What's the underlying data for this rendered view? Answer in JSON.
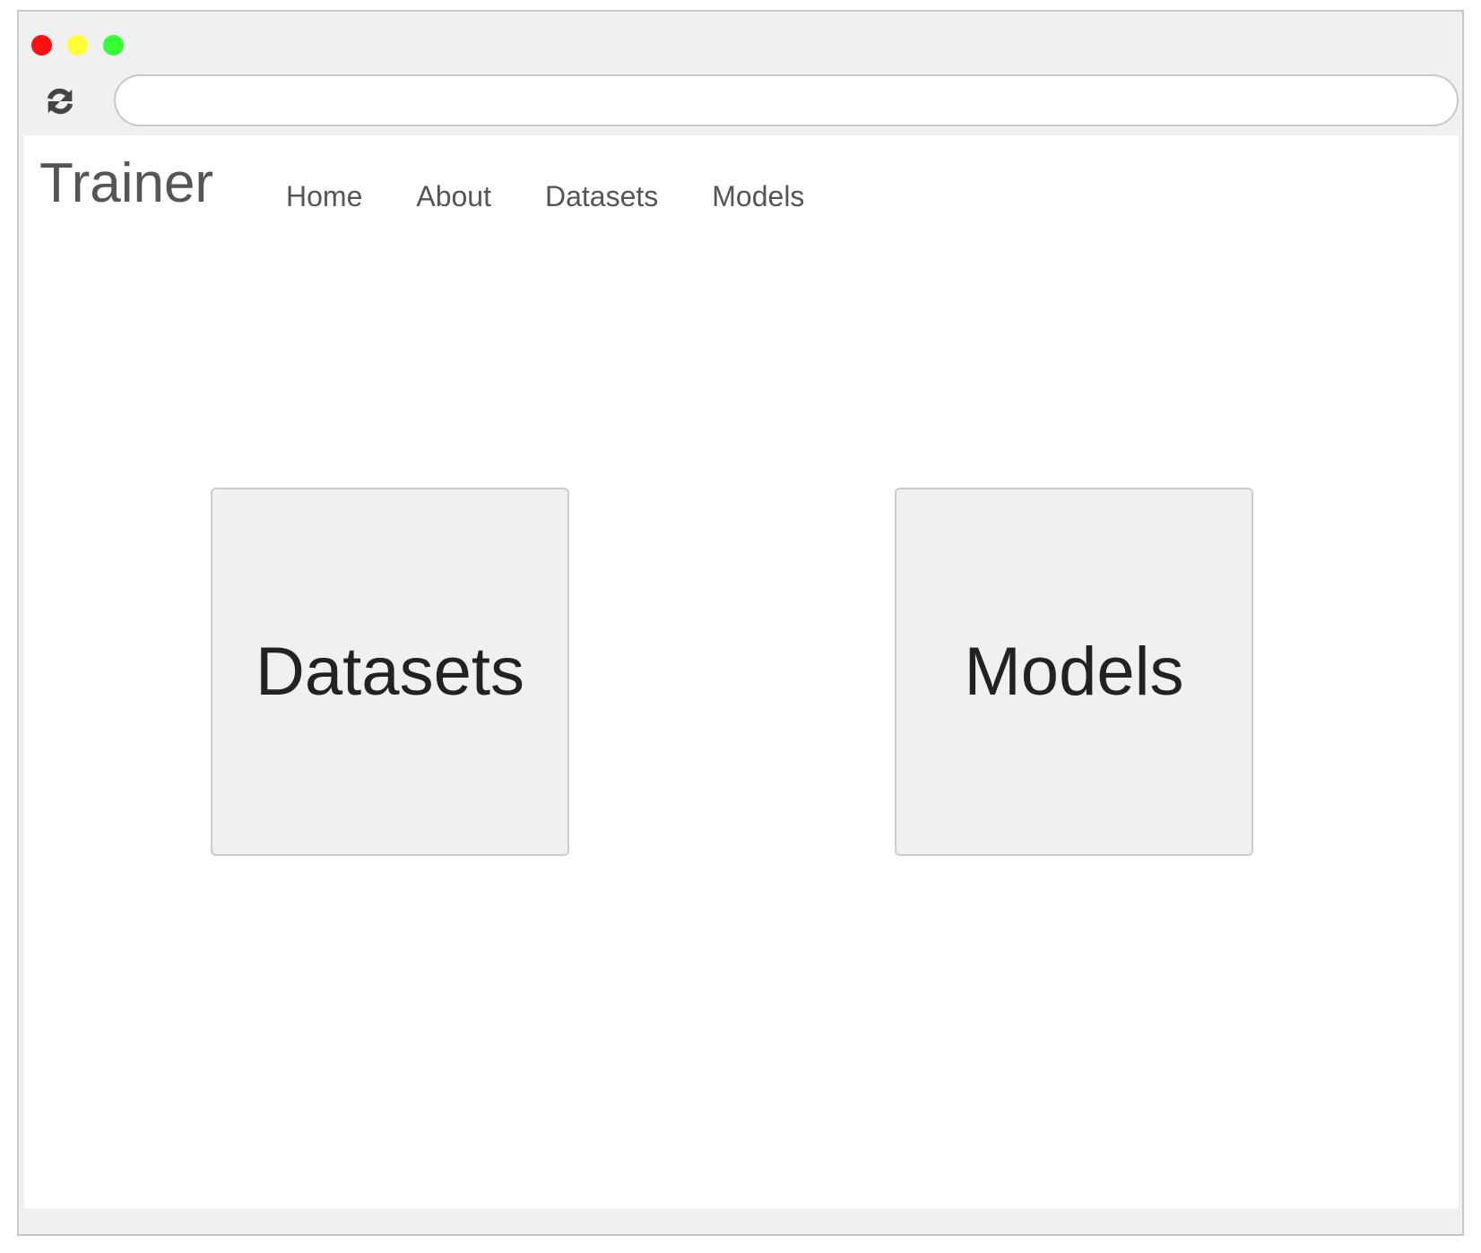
{
  "window": {
    "controls": [
      {
        "name": "close",
        "color": "#ff0f0f"
      },
      {
        "name": "minimize",
        "color": "#ffff33"
      },
      {
        "name": "maximize",
        "color": "#33ff33"
      }
    ],
    "reload_icon": "refresh-icon",
    "address_bar": {
      "value": "",
      "placeholder": ""
    }
  },
  "header": {
    "brand": "Trainer",
    "nav": [
      "Home",
      "About",
      "Datasets",
      "Models"
    ]
  },
  "main": {
    "cards": [
      {
        "label": "Datasets"
      },
      {
        "label": "Models"
      }
    ]
  },
  "colors": {
    "chrome_bg": "#f0f0f0",
    "text_muted": "#555555",
    "card_bg": "#f0f0f0",
    "card_border": "#cccccc"
  }
}
